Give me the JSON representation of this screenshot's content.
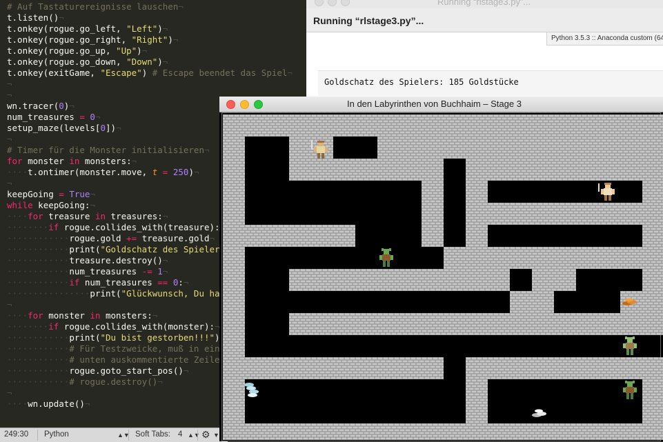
{
  "editor": {
    "lines": [
      "# Auf Tastaturereignisse lauschen",
      "t.listen()",
      "t.onkey(rogue.go_left, \"Left\")",
      "t.onkey(rogue.go_right, \"Right\")",
      "t.onkey(rogue.go_up, \"Up\")",
      "t.onkey(rogue.go_down, \"Down\")",
      "t.onkey(exitGame, \"Escape\") # Escape beendet das Spiel",
      "",
      "",
      "wn.tracer(0)",
      "num_treasures = 0",
      "setup_maze(levels[0])",
      "",
      "# Timer für die Monster initialisieren",
      "for monster in monsters:",
      "    t.ontimer(monster.move, t = 250)",
      "",
      "keepGoing = True",
      "while keepGoing:",
      "    for treasure in treasures:",
      "        if rogue.collides_with(treasure):",
      "            rogue.gold += treasure.gold",
      "            print(\"Goldschatz des Spielers:",
      "            treasure.destroy()",
      "            num_treasures -= 1",
      "            if num_treasures == 0:",
      "                print(\"Glückwunsch, Du hast",
      "",
      "    for monster in monsters:",
      "        if rogue.collides_with(monster):",
      "            print(\"Du bist gestorben!!!\")",
      "            # Für Testzweicke, muß in einem",
      "            # unten auskommentierte Zeile e",
      "            rogue.goto_start_pos()",
      "            # rogue.destroy()",
      "",
      "    wn.update()"
    ],
    "status": {
      "position": "249:30",
      "syntax": "Python",
      "tabs_label": "Soft Tabs:",
      "tabs_value": "4"
    }
  },
  "console": {
    "window_title": "Running “rlstage3.py”...",
    "running_label": "Running “rlstage3.py”...",
    "python_version": "Python 3.5.3 :: Anaconda custom (64-bit)",
    "output": "Goldschatz des Spielers: 185 Goldstücke"
  },
  "game": {
    "window_title": "In den Labyrinthen von Buchhaim – Stage 3",
    "maze": [
      "XXXXXXXXXXXXXXXXXXXX",
      "X  XX  XXXXXXXXXXXXX",
      "X  XXXXXXX XXXXXXXXX",
      "X        X X       X",
      "X        X XXXXXXXXX",
      "XXXXXX   X X       X",
      "X         XXXXXXXXXX",
      "X  XXXXXXXXXX XX   X",
      "X            XX   XX",
      "X  XXXXXXXXXXXXXXXXX",
      "X                   X",
      "XXXXXXXXXX XXXXXXXXX",
      "X          X       X",
      "X          X       X",
      "XXXXXXXXXXXXXXXXXXXX"
    ],
    "colors": {
      "brick": "#c8c8c8",
      "mortar": "#8a8a8a",
      "floor": "#000000"
    },
    "sprites": [
      {
        "kind": "rogue",
        "name": "knight-player-icon"
      },
      {
        "kind": "rogue",
        "name": "knight-monster-icon"
      },
      {
        "kind": "goblin",
        "name": "goblin-monster-icon"
      },
      {
        "kind": "goblin",
        "name": "goblin-monster-icon"
      },
      {
        "kind": "goblin",
        "name": "goblin-monster-icon"
      }
    ],
    "treasures": [
      {
        "kind": "gold-coins",
        "color": "#e08a2a"
      },
      {
        "kind": "silver-coins",
        "color": "#cfe6ef"
      },
      {
        "kind": "silver-coins",
        "color": "#e8e8e8"
      }
    ]
  }
}
